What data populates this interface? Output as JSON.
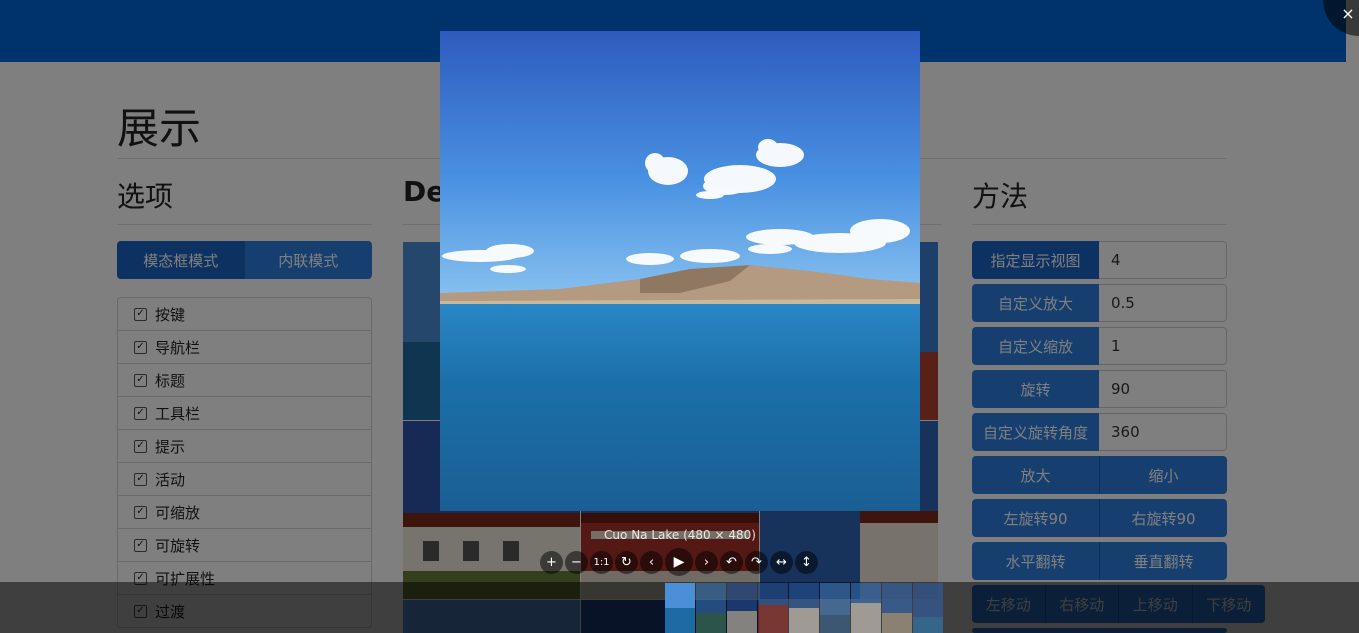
{
  "page": {
    "title": "展示"
  },
  "options": {
    "heading": "选项",
    "modes": [
      "模态框模式",
      "内联模式"
    ],
    "items": [
      {
        "label": "按键",
        "checked": true
      },
      {
        "label": "导航栏",
        "checked": true
      },
      {
        "label": "标题",
        "checked": true
      },
      {
        "label": "工具栏",
        "checked": true
      },
      {
        "label": "提示",
        "checked": true
      },
      {
        "label": "活动",
        "checked": true
      },
      {
        "label": "可缩放",
        "checked": true
      },
      {
        "label": "可旋转",
        "checked": true
      },
      {
        "label": "可扩展性",
        "checked": true
      },
      {
        "label": "过渡",
        "checked": true
      }
    ]
  },
  "demo": {
    "heading": "Demo"
  },
  "methods": {
    "heading": "方法",
    "view": {
      "label": "指定显示视图",
      "value": "4"
    },
    "zoom": {
      "label": "自定义放大",
      "value": "0.5"
    },
    "zoom_to": {
      "label": "自定义缩放",
      "value": "1"
    },
    "rotate": {
      "label": "旋转",
      "value": "90"
    },
    "rotate_to": {
      "label": "自定义旋转角度",
      "value": "360"
    },
    "zoom_in": "放大",
    "zoom_out": "缩小",
    "rotate_left": "左旋转90",
    "rotate_right": "右旋转90",
    "flip_h": "水平翻转",
    "flip_v": "垂直翻转",
    "move_left": "左移动",
    "move_right": "右移动",
    "move_up": "上移动",
    "move_down": "下移动"
  },
  "viewer": {
    "title": "Cuo Na Lake (480 × 480)",
    "close_symbol": "×",
    "toolbar": [
      {
        "name": "zoom-in",
        "glyph": "+"
      },
      {
        "name": "zoom-out",
        "glyph": "−"
      },
      {
        "name": "one-to-one",
        "glyph": "1:1"
      },
      {
        "name": "reset",
        "glyph": "↻"
      },
      {
        "name": "prev",
        "glyph": "‹"
      },
      {
        "name": "play",
        "glyph": "▶"
      },
      {
        "name": "next",
        "glyph": "›"
      },
      {
        "name": "rotate-left",
        "glyph": "↶"
      },
      {
        "name": "rotate-right",
        "glyph": "↷"
      },
      {
        "name": "flip-horizontal",
        "glyph": "↔"
      },
      {
        "name": "flip-vertical",
        "glyph": "↕"
      }
    ],
    "thumbnail_count": 9,
    "active_thumbnail": 1
  },
  "colors": {
    "accent": "#2c7fe0",
    "accent_dark": "#1a63c2",
    "topbar": "#0066d9",
    "sky": "#3d8fe0",
    "lake": "#1a6fa8"
  }
}
